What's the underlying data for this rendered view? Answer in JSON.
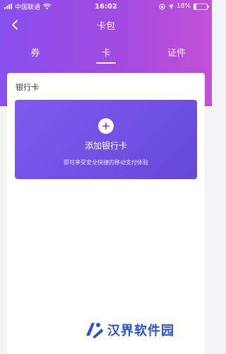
{
  "status_bar": {
    "carrier": "中国联通",
    "time": "16:02",
    "battery": "18%",
    "battery_level": 0.18
  },
  "nav": {
    "title": "卡包",
    "back_icon": "chevron-left-icon"
  },
  "tabs": [
    {
      "label": "券",
      "active": false
    },
    {
      "label": "卡",
      "active": true
    },
    {
      "label": "证件",
      "active": false
    }
  ],
  "bank_section": {
    "title": "银行卡",
    "add_card": {
      "label": "添加银行卡",
      "description": "即可享受安全快捷的移动支付体验",
      "icon": "plus-icon"
    }
  },
  "watermark": {
    "text": "汉界软件园"
  },
  "colors": {
    "header_start": "#8a4ff0",
    "header_end": "#c44fd6",
    "card_start": "#7d5bf0",
    "card_end": "#6648d8",
    "watermark": "#2a4fd9"
  }
}
